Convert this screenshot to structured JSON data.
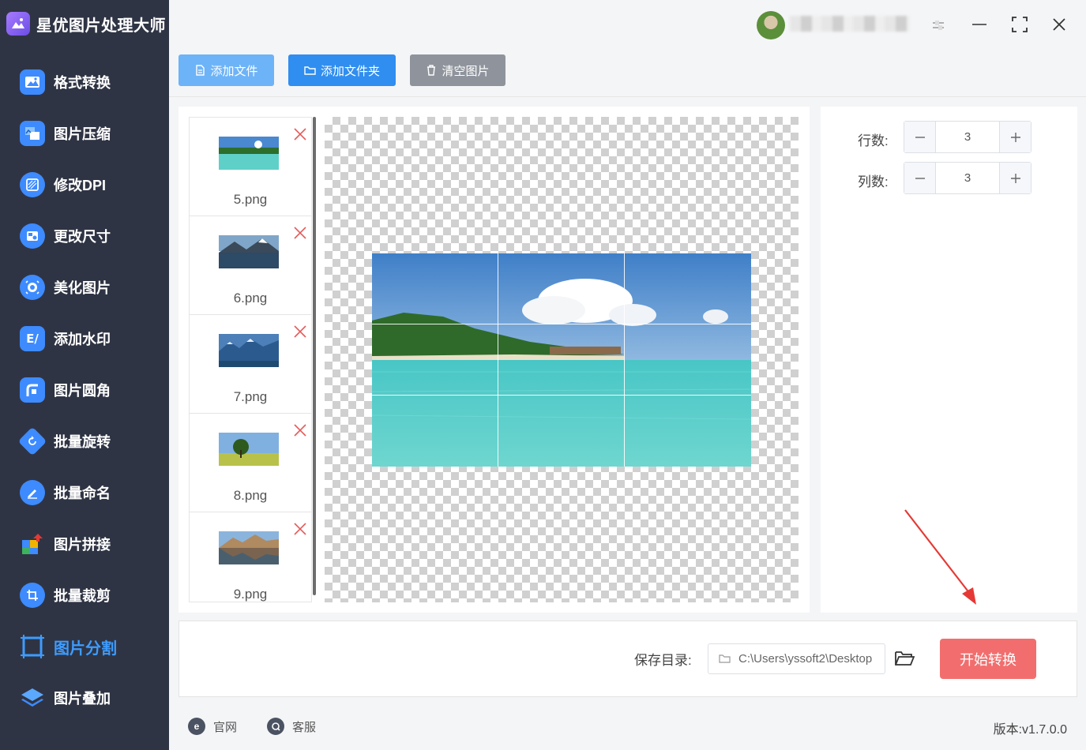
{
  "app": {
    "title": "星优图片处理大师"
  },
  "sidebar": {
    "items": [
      {
        "label": "格式转换",
        "icon": "image-convert-icon",
        "color": "#3d8bff"
      },
      {
        "label": "图片压缩",
        "icon": "image-compress-icon",
        "color": "#3d8bff"
      },
      {
        "label": "修改DPI",
        "icon": "dpi-icon",
        "color": "#3d8bff"
      },
      {
        "label": "更改尺寸",
        "icon": "resize-icon",
        "color": "#3d8bff"
      },
      {
        "label": "美化图片",
        "icon": "beautify-icon",
        "color": "#3d8bff"
      },
      {
        "label": "添加水印",
        "icon": "watermark-icon",
        "color": "#3d8bff"
      },
      {
        "label": "图片圆角",
        "icon": "rounded-corner-icon",
        "color": "#3d8bff"
      },
      {
        "label": "批量旋转",
        "icon": "rotate-icon",
        "color": "#3d8bff"
      },
      {
        "label": "批量命名",
        "icon": "rename-icon",
        "color": "#3d8bff"
      },
      {
        "label": "图片拼接",
        "icon": "puzzle-icon",
        "color": "#3db35e"
      },
      {
        "label": "批量裁剪",
        "icon": "crop-icon",
        "color": "#3d8bff"
      },
      {
        "label": "图片分割",
        "icon": "split-icon",
        "color": "#3d9cff",
        "active": true
      },
      {
        "label": "图片叠加",
        "icon": "layers-icon",
        "color": "#3d8bff"
      }
    ]
  },
  "toolbar": {
    "add_file": "添加文件",
    "add_folder": "添加文件夹",
    "clear": "清空图片"
  },
  "files": [
    {
      "name": "5.png",
      "thumb": "beach"
    },
    {
      "name": "6.png",
      "thumb": "lake-mountain"
    },
    {
      "name": "7.png",
      "thumb": "blue-mountains"
    },
    {
      "name": "8.png",
      "thumb": "tree-field"
    },
    {
      "name": "9.png",
      "thumb": "mountain-reflection"
    }
  ],
  "settings": {
    "rows_label": "行数:",
    "rows_value": "3",
    "cols_label": "列数:",
    "cols_value": "3"
  },
  "bottom": {
    "save_label": "保存目录:",
    "save_path": "C:\\Users\\yssoft2\\Desktop",
    "start_button": "开始转换"
  },
  "footer": {
    "website": "官网",
    "support": "客服",
    "version": "版本:v1.7.0.0"
  },
  "colors": {
    "sidebar_bg": "#2f3444",
    "accent": "#3d9cff",
    "start_button": "#f26e6e",
    "add_file_button": "#6db3f8",
    "add_folder_button": "#2f8ef0",
    "clear_button": "#8f949c"
  }
}
